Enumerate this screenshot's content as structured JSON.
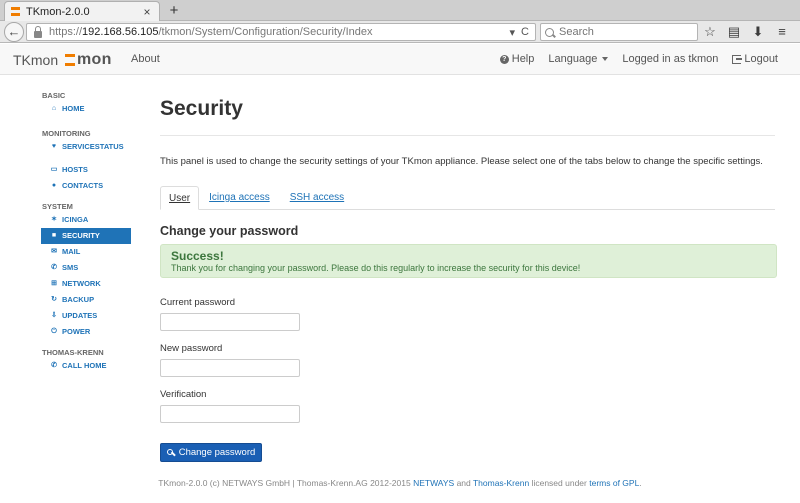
{
  "browser": {
    "tab_title": "TKmon-2.0.0",
    "tab_close": "×",
    "new_tab": "+",
    "back": "←",
    "url_scheme": "https://",
    "url_host": "192.168.56.105",
    "url_path": "/tkmon/System/Configuration/Security/Index",
    "url_dropdown": "▾",
    "url_reload": "C",
    "search_placeholder": "Search",
    "icons": [
      "star-icon",
      "reading-list-icon",
      "download-icon",
      "menu-icon"
    ]
  },
  "header": {
    "brand": "TKmon",
    "logo_text": "mon",
    "about": "About",
    "help": "Help",
    "language": "Language",
    "logged_in": "Logged in as tkmon",
    "logout": "Logout"
  },
  "sidebar": {
    "basic": "BASIC",
    "home": "HOME",
    "monitoring": "MONITORING",
    "servicestatus": "SERVICESTATUS",
    "hosts": "HOSTS",
    "contacts": "CONTACTS",
    "system": "SYSTEM",
    "icinga": "ICINGA",
    "security": "SECURITY",
    "mail": "MAIL",
    "sms": "SMS",
    "network": "NETWORK",
    "backup": "BACKUP",
    "updates": "UPDATES",
    "power": "POWER",
    "thomas_krenn": "THOMAS-KRENN",
    "call_home": "CALL HOME"
  },
  "main": {
    "title": "Security",
    "intro": "This panel is used to change the security settings of your TKmon appliance. Please select one of the tabs below to change the specific settings.",
    "tabs": [
      "User",
      "Icinga access",
      "SSH access"
    ],
    "section_title": "Change your password",
    "alert_title": "Success!",
    "alert_body": "Thank you for changing your password. Please do this regularly to increase the security for this device!",
    "current_password_label": "Current password",
    "new_password_label": "New password",
    "verification_label": "Verification",
    "current_password_value": "",
    "new_password_value": "",
    "verification_value": "",
    "submit": "Change password"
  },
  "footer": {
    "prefix": "TKmon-2.0.0 (c) NETWAYS GmbH | Thomas-Krenn.AG 2012-2015",
    "netways": "NETWAYS",
    "and": "and",
    "thomas_krenn": "Thomas-Krenn",
    "licensed": "licensed under",
    "gpl": "terms of GPL",
    "period": "."
  },
  "colors": {
    "accent": "#1f73b7",
    "brand_orange": "#f07d00",
    "success_bg": "#dff0d8",
    "success_text": "#3c763d",
    "button": "#1a5fb4"
  }
}
